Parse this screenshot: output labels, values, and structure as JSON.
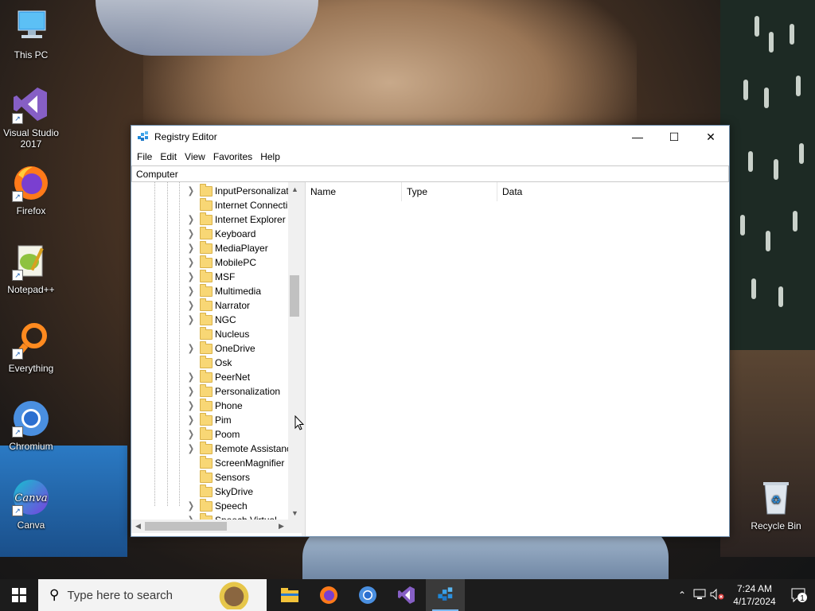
{
  "desktop": {
    "icons": [
      {
        "label": "This PC",
        "icon": "computer-icon"
      },
      {
        "label": "Visual Studio 2017",
        "icon": "visual-studio-icon"
      },
      {
        "label": "Firefox",
        "icon": "firefox-icon"
      },
      {
        "label": "Notepad++",
        "icon": "notepadpp-icon"
      },
      {
        "label": "Everything",
        "icon": "everything-search-icon"
      },
      {
        "label": "Chromium",
        "icon": "chromium-icon"
      },
      {
        "label": "Canva",
        "icon": "canva-icon",
        "logo_text": "Canva"
      },
      {
        "label": "Recycle Bin",
        "icon": "recycle-bin-icon"
      }
    ]
  },
  "window": {
    "title": "Registry Editor",
    "controls": {
      "minimize": "—",
      "maximize": "☐",
      "close": "✕"
    },
    "menu": [
      "File",
      "Edit",
      "View",
      "Favorites",
      "Help"
    ],
    "address": "Computer",
    "tree_items": [
      {
        "label": "InputPersonalizat",
        "expandable": true
      },
      {
        "label": "Internet Connecti",
        "expandable": false
      },
      {
        "label": "Internet Explorer",
        "expandable": true
      },
      {
        "label": "Keyboard",
        "expandable": true
      },
      {
        "label": "MediaPlayer",
        "expandable": true
      },
      {
        "label": "MobilePC",
        "expandable": true
      },
      {
        "label": "MSF",
        "expandable": true
      },
      {
        "label": "Multimedia",
        "expandable": true
      },
      {
        "label": "Narrator",
        "expandable": true
      },
      {
        "label": "NGC",
        "expandable": true
      },
      {
        "label": "Nucleus",
        "expandable": false
      },
      {
        "label": "OneDrive",
        "expandable": true
      },
      {
        "label": "Osk",
        "expandable": false
      },
      {
        "label": "PeerNet",
        "expandable": true
      },
      {
        "label": "Personalization",
        "expandable": true
      },
      {
        "label": "Phone",
        "expandable": true
      },
      {
        "label": "Pim",
        "expandable": true
      },
      {
        "label": "Poom",
        "expandable": true
      },
      {
        "label": "Remote Assistanc",
        "expandable": true
      },
      {
        "label": "ScreenMagnifier",
        "expandable": false
      },
      {
        "label": "Sensors",
        "expandable": false
      },
      {
        "label": "SkyDrive",
        "expandable": false
      },
      {
        "label": "Speech",
        "expandable": true
      },
      {
        "label": "Speech Virtual",
        "expandable": true
      }
    ],
    "columns": [
      "Name",
      "Type",
      "Data"
    ]
  },
  "taskbar": {
    "search_placeholder": "Type here to search",
    "apps": [
      "file-explorer-icon",
      "firefox-icon",
      "chromium-icon",
      "visual-studio-icon",
      "registry-editor-icon"
    ],
    "clock_time": "7:24 AM",
    "clock_date": "4/17/2024",
    "notification_count": "1"
  },
  "colors": {
    "accent": "#0078d7",
    "folder": "#f8d775",
    "taskbar": "#1c1c1c"
  }
}
